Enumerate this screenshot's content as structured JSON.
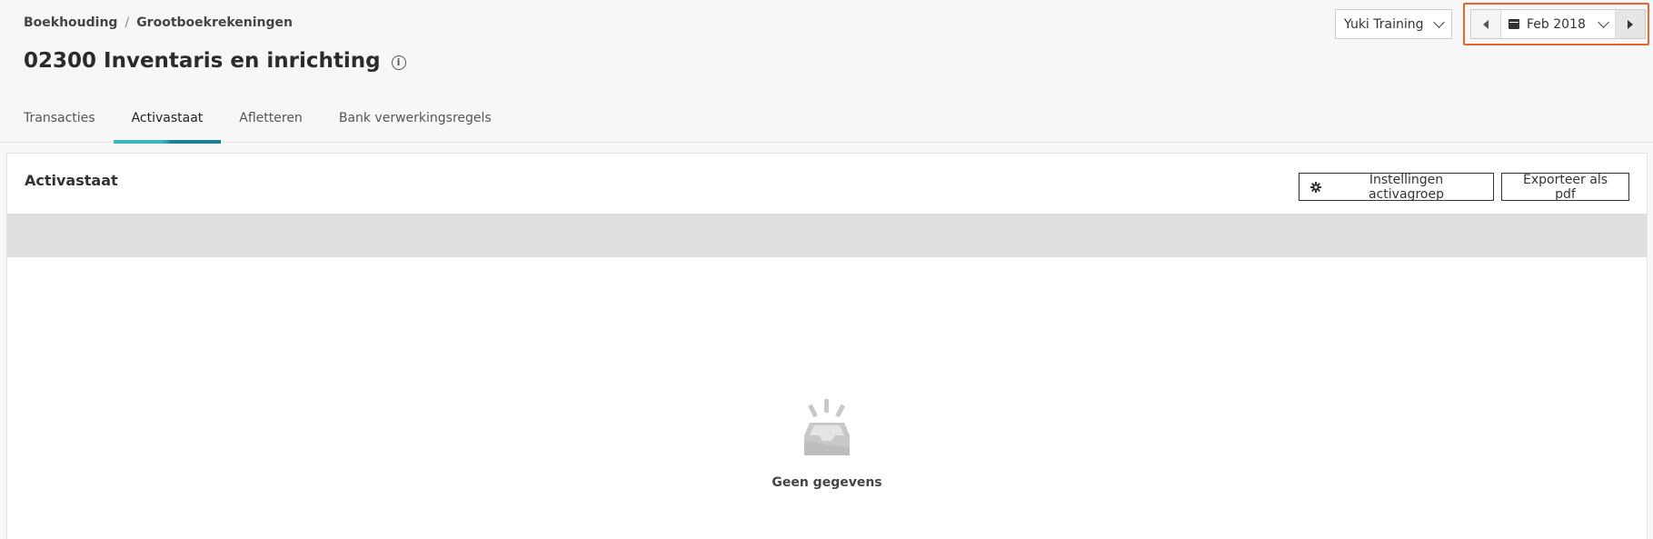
{
  "breadcrumb": {
    "items": [
      "Boekhouding",
      "Grootboekrekeningen"
    ],
    "separator": "/"
  },
  "page": {
    "title": "02300 Inventaris en inrichting",
    "info_icon": "info-icon"
  },
  "company_select": {
    "value": "Yuki Training"
  },
  "period_picker": {
    "value": "Feb 2018",
    "highlight_color": "#e8672c"
  },
  "tabs": [
    {
      "label": "Transacties",
      "active": false
    },
    {
      "label": "Activastaat",
      "active": true
    },
    {
      "label": "Afletteren",
      "active": false
    },
    {
      "label": "Bank verwerkingsregels",
      "active": false
    }
  ],
  "card": {
    "title": "Activastaat",
    "settings_button": "Instellingen activagroep",
    "export_button": "Exporteer als pdf",
    "empty_text": "Geen gegevens"
  },
  "colors": {
    "accent": "#1a7f95",
    "accent_light": "#3fb3c6",
    "highlight": "#e8672c"
  }
}
